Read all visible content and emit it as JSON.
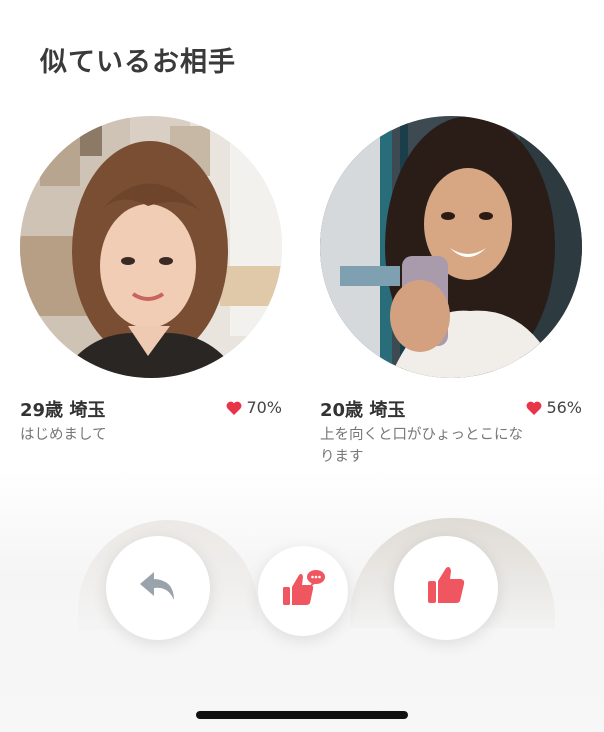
{
  "section_title": "似ているお相手",
  "profiles": [
    {
      "age_location": "29歳 埼玉",
      "match_percent": "70%",
      "message": "はじめまして"
    },
    {
      "age_location": "20歳 埼玉",
      "match_percent": "56%",
      "message": "上を向くと口がひょっとこにな\nります"
    }
  ],
  "actions": [
    {
      "icon": "undo-arrow-icon"
    },
    {
      "icon": "like-with-message-icon"
    },
    {
      "icon": "thumbs-up-icon"
    }
  ],
  "colors": {
    "accent": "#f0565f",
    "heart": "#e8354a"
  }
}
